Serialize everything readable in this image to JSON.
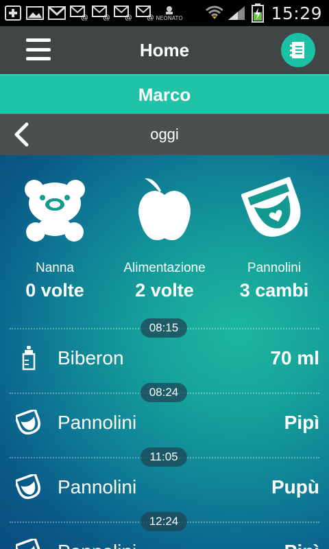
{
  "status_bar": {
    "time": "15:29",
    "brand_text": "NEONATO",
    "icons": [
      "plus-icon",
      "image-icon",
      "gmail-icon",
      "email-at-icon",
      "email-at-icon",
      "email-at-icon",
      "email-at-icon",
      "neonato-icon",
      "wifi-icon",
      "signal-icon",
      "battery-charging-icon"
    ]
  },
  "header": {
    "title": "Home"
  },
  "child": {
    "name": "Marco"
  },
  "date": {
    "label": "oggi"
  },
  "summary": [
    {
      "label": "Nanna",
      "value": "0 volte",
      "icon": "teddy-bear-icon"
    },
    {
      "label": "Alimentazione",
      "value": "2 volte",
      "icon": "apple-icon"
    },
    {
      "label": "Pannolini",
      "value": "3 cambi",
      "icon": "diaper-icon"
    }
  ],
  "timeline": [
    {
      "time": "08:15",
      "label": "Biberon",
      "value": "70 ml",
      "icon": "bottle-icon"
    },
    {
      "time": "08:24",
      "label": "Pannolini",
      "value": "Pipì",
      "icon": "diaper-icon"
    },
    {
      "time": "11:05",
      "label": "Pannolini",
      "value": "Pupù",
      "icon": "diaper-icon"
    },
    {
      "time": "12:24",
      "label": "Pannolini",
      "value": "Pipì",
      "icon": "diaper-icon"
    }
  ],
  "colors": {
    "accent": "#20c3a8",
    "toolbar": "#404546",
    "datebar": "#4a4f50"
  }
}
